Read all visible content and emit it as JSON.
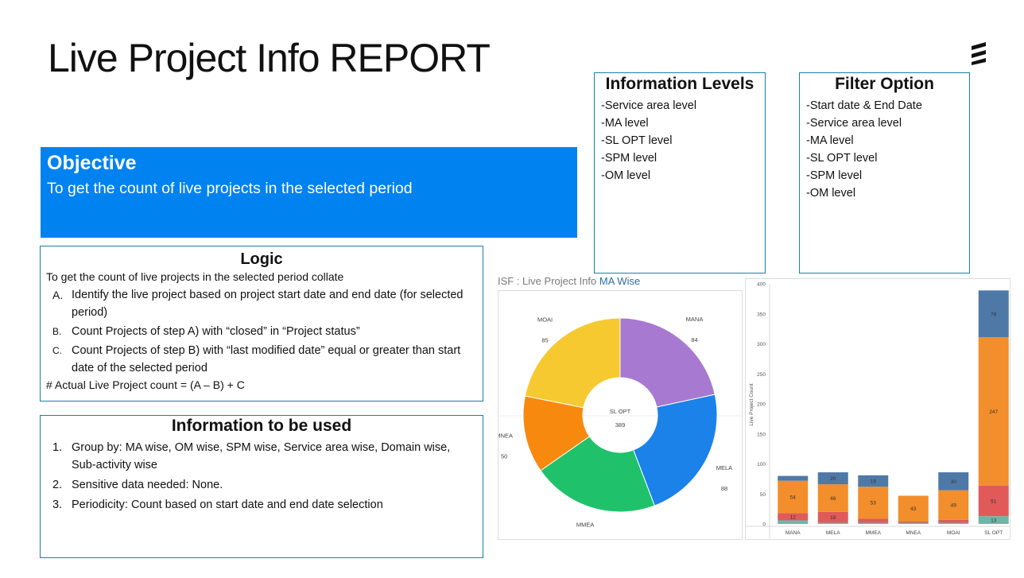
{
  "page": {
    "title": "Live Project Info REPORT"
  },
  "objective": {
    "heading": "Objective",
    "text": "To get the count of live projects in the selected period"
  },
  "info_levels": {
    "heading": "Information Levels",
    "items": [
      "-Service area level",
      "-MA level",
      "-SL OPT level",
      "-SPM level",
      "-OM level"
    ]
  },
  "filter_option": {
    "heading": "Filter Option",
    "items": [
      "-Start date & End Date",
      "-Service area level",
      "-MA level",
      "-SL OPT level",
      "-SPM level",
      "-OM level"
    ]
  },
  "logic": {
    "heading": "Logic",
    "intro": "To get the count of live projects in the selected period collate",
    "steps": [
      {
        "marker": "A.",
        "text": "Identify the live project based on project start date and end date (for selected period)"
      },
      {
        "marker": "B.",
        "text": "Count Projects of step A) with “closed” in “Project status”"
      },
      {
        "marker": "C.",
        "text": "Count Projects of step B) with “last modified date” equal or greater than start date of the selected period"
      }
    ],
    "formula": "# Actual Live Project count = (A – B) + C"
  },
  "info_used": {
    "heading": "Information to be used",
    "items": [
      {
        "marker": "1.",
        "text": "Group by: MA wise, OM wise, SPM wise, Service area  wise, Domain wise, Sub-activity wise"
      },
      {
        "marker": "2.",
        "text": "Sensitive data needed: None."
      },
      {
        "marker": "3.",
        "text": "Periodicity: Count based on start date and end date selection"
      }
    ]
  },
  "isf_title": {
    "prefix": "ISF : Live Project Info",
    "highlight": "MA Wise"
  },
  "chart_data": [
    {
      "type": "pie",
      "variant": "donut",
      "center_label": "SL OPT",
      "center_value": 389,
      "categories": [
        "MANA",
        "MELA",
        "MMEA",
        "MNEA",
        "MOAI"
      ],
      "values": [
        84,
        88,
        82,
        50,
        85
      ],
      "colors": [
        "#a779d1",
        "#1a82e8",
        "#1fc26b",
        "#f7890e",
        "#f6c930"
      ]
    },
    {
      "type": "bar",
      "stacked": true,
      "ylabel": "Live Project Count",
      "ylim": [
        0,
        400
      ],
      "yticks": [
        0,
        50,
        100,
        150,
        200,
        250,
        300,
        350,
        400
      ],
      "categories": [
        "MANA",
        "MELA",
        "MMEA",
        "MNEA",
        "MOAI",
        "SL OPT"
      ],
      "colors": [
        "#70b6a8",
        "#e05a5a",
        "#f28e2b",
        "#4e79a7"
      ],
      "series": [
        {
          "values": [
            6,
            2,
            2,
            2,
            2,
            13
          ]
        },
        {
          "values": [
            12,
            18,
            7,
            2,
            5,
            51
          ]
        },
        {
          "values": [
            54,
            46,
            53,
            43,
            49,
            247
          ]
        },
        {
          "values": [
            8,
            20,
            19,
            0,
            30,
            78
          ]
        }
      ],
      "labels": [
        [
          null,
          null,
          null,
          null,
          null,
          "13"
        ],
        [
          "12",
          "18",
          null,
          null,
          null,
          "51"
        ],
        [
          "54",
          "46",
          "53",
          "43",
          "49",
          "247"
        ],
        [
          null,
          "20",
          "19",
          null,
          "30",
          "78"
        ]
      ],
      "grid": false,
      "legend": "none"
    }
  ]
}
